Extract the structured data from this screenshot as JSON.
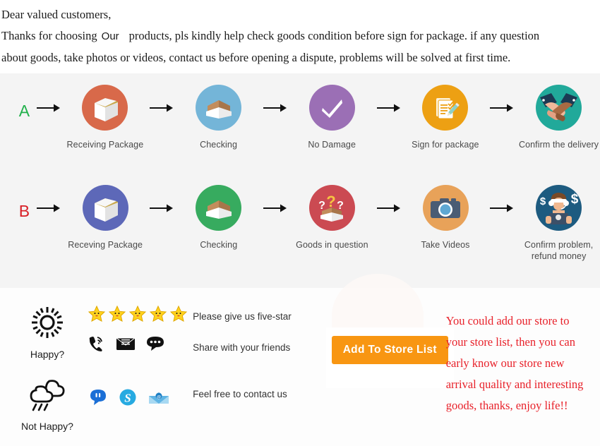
{
  "intro": {
    "line1": "Dear valued customers,",
    "line2_a": "Thanks for choosing",
    "line2_our": "Our",
    "line2_b": "products, pls kindly help check goods condition before sign for package. if any question",
    "line3": "about goods, take photos or videos, contact us before opening a dispute, problems will be solved at first time."
  },
  "flow": {
    "row_a": {
      "letter": "A",
      "letter_color": "#22b14c",
      "steps": [
        {
          "label": "Receiving Package",
          "icon": "closed-box-icon",
          "circle_color": "#d8694a"
        },
        {
          "label": "Checking",
          "icon": "open-box-icon",
          "circle_color": "#74b5d8"
        },
        {
          "label": "No Damage",
          "icon": "checkmark-icon",
          "circle_color": "#9b6fb5"
        },
        {
          "label": "Sign for package",
          "icon": "signed-document-icon",
          "circle_color": "#eda013"
        },
        {
          "label": "Confirm the delivery",
          "icon": "handshake-icon",
          "circle_color": "#21a99a"
        }
      ]
    },
    "row_b": {
      "letter": "B",
      "letter_color": "#d81f26",
      "steps": [
        {
          "label": "Receving Package",
          "icon": "closed-box-icon",
          "circle_color": "#5d68b8"
        },
        {
          "label": "Checking",
          "icon": "open-box-icon",
          "circle_color": "#37ab5f"
        },
        {
          "label": "Goods in question",
          "icon": "question-box-icon",
          "circle_color": "#cb4a52"
        },
        {
          "label": "Take Videos",
          "icon": "camera-icon",
          "circle_color": "#e8a259"
        },
        {
          "label": "Confirm problem,\nrefund money",
          "label_line1": "Confirm problem,",
          "label_line2": "refund money",
          "icon": "support-agent-icon",
          "circle_color": "#1d5b80"
        }
      ]
    },
    "arrow_icon": "arrow-right-icon"
  },
  "bottom": {
    "mood_happy": {
      "label": "Happy?",
      "icon": "sun-icon"
    },
    "mood_sad": {
      "label": "Not Happy?",
      "icon": "rain-cloud-icon"
    },
    "stars": {
      "count": 5,
      "icon": "star-icon",
      "color": "#ffd21e"
    },
    "contact_icons_happy": [
      "phone-icon",
      "envelope-icon",
      "chat-bubble-icon"
    ],
    "contact_icons_sad": [
      "aliwangwang-icon",
      "skype-icon",
      "email-icon"
    ],
    "captions": [
      "Please give us five-star",
      "Share with your friends",
      "Feel free to contact us"
    ],
    "store_button": "Add To Store List",
    "store_button_color": "#f89612",
    "promo_color": "#e8212a",
    "promo_lines": [
      "You could add our store to",
      "your store list, then you can",
      "early know our store new",
      "arrival quality and interesting",
      "goods, thanks, enjoy life!!"
    ]
  }
}
